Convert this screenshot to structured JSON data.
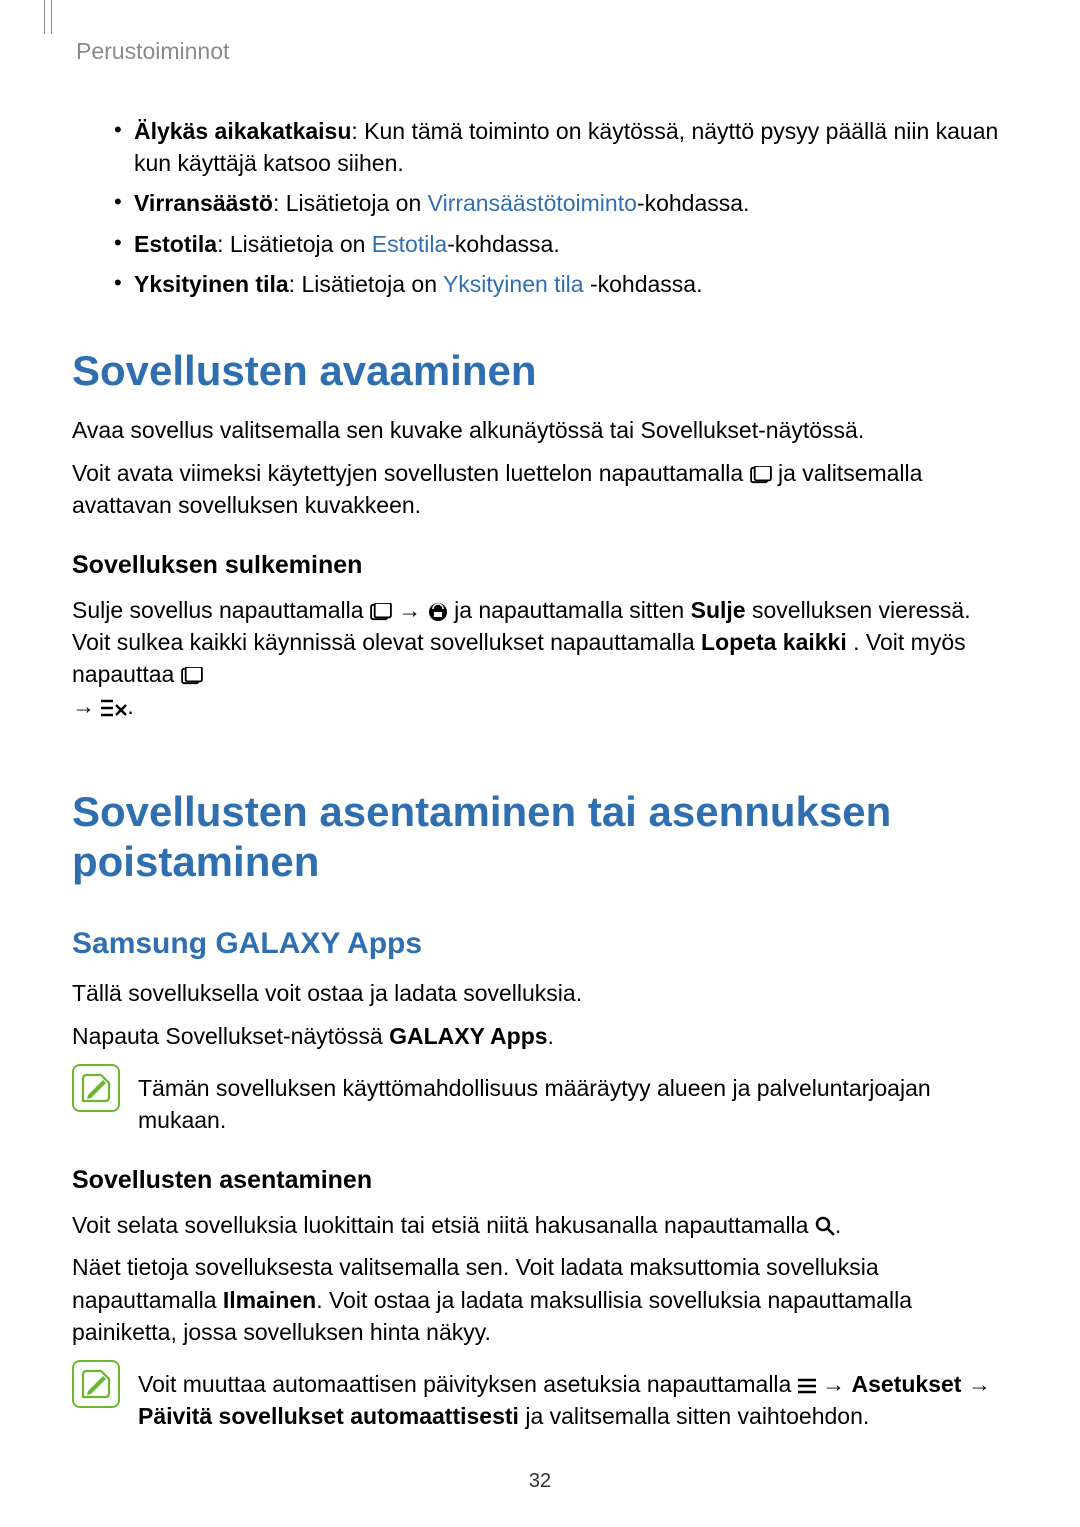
{
  "header": {
    "section": "Perustoiminnot"
  },
  "bullets": [
    {
      "bold": "Älykäs aikakatkaisu",
      "text": ": Kun tämä toiminto on käytössä, näyttö pysyy päällä niin kauan kun käyttäjä katsoo siihen."
    },
    {
      "bold": "Virransäästö",
      "pre": ": Lisätietoja on ",
      "link": "Virransäästötoiminto",
      "post": "-kohdassa."
    },
    {
      "bold": "Estotila",
      "pre": ": Lisätietoja on ",
      "link": "Estotila",
      "post": "-kohdassa."
    },
    {
      "bold": "Yksityinen tila",
      "pre": ": Lisätietoja on ",
      "link": "Yksityinen tila",
      "post": " -kohdassa."
    }
  ],
  "s1": {
    "title": "Sovellusten avaaminen",
    "p1": "Avaa sovellus valitsemalla sen kuvake alkunäytössä tai Sovellukset-näytössä.",
    "p2a": "Voit avata viimeksi käytettyjen sovellusten luettelon napauttamalla ",
    "p2b": " ja valitsemalla avattavan sovelluksen kuvakkeen.",
    "sub": "Sovelluksen sulkeminen",
    "p3a": "Sulje sovellus napauttamalla ",
    "p3b": " ja napauttamalla sitten ",
    "p3_bold1": "Sulje",
    "p3c": " sovelluksen vieressä. Voit sulkea kaikki käynnissä olevat sovellukset napauttamalla ",
    "p3_bold2": "Lopeta kaikki",
    "p3d": ". Voit myös napauttaa ",
    "arrow": "→"
  },
  "s2": {
    "title": "Sovellusten asentaminen tai asennuksen poistaminen",
    "h2": "Samsung GALAXY Apps",
    "p1": "Tällä sovelluksella voit ostaa ja ladata sovelluksia.",
    "p2a": "Napauta Sovellukset-näytössä ",
    "p2_bold": "GALAXY Apps",
    "p2b": ".",
    "note1": "Tämän sovelluksen käyttömahdollisuus määräytyy alueen ja palveluntarjoajan mukaan.",
    "sub": "Sovellusten asentaminen",
    "p3a": "Voit selata sovelluksia luokittain tai etsiä niitä hakusanalla napauttamalla ",
    "p3b": ".",
    "p4a": "Näet tietoja sovelluksesta valitsemalla sen. Voit ladata maksuttomia sovelluksia napauttamalla ",
    "p4_bold": "Ilmainen",
    "p4b": ". Voit ostaa ja ladata maksullisia sovelluksia napauttamalla painiketta, jossa sovelluksen hinta näkyy.",
    "note2a": "Voit muuttaa automaattisen päivityksen asetuksia napauttamalla ",
    "note2_bold1": "Asetukset",
    "note2_bold2": "Päivitä sovellukset automaattisesti",
    "note2b": " ja valitsemalla sitten vaihtoehdon."
  },
  "page_number": "32"
}
